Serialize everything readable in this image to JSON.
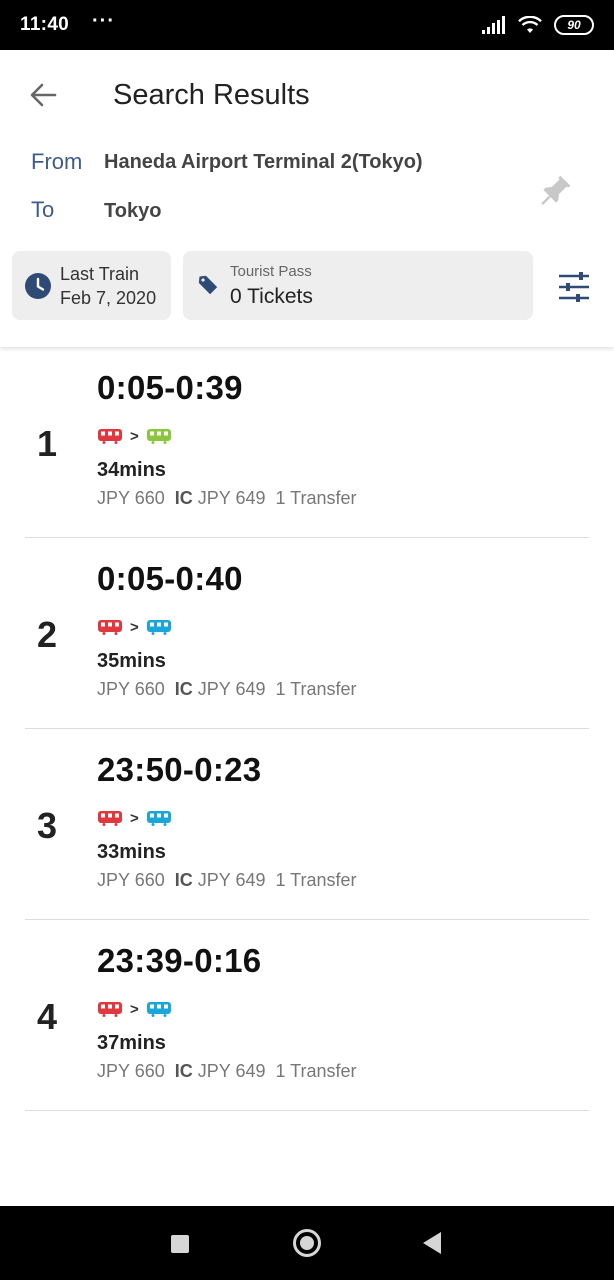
{
  "status_bar": {
    "time": "11:40",
    "dots": "···",
    "battery": "90"
  },
  "header": {
    "title": "Search Results",
    "from_label": "From",
    "from_value": "Haneda Airport Terminal 2(Tokyo)",
    "to_label": "To",
    "to_value": "Tokyo",
    "time_chip": {
      "line1": "Last Train",
      "line2": "Feb 7, 2020"
    },
    "pass_chip": {
      "label": "Tourist Pass",
      "count": "0 Tickets"
    }
  },
  "colors": {
    "accent": "#3e5c8a",
    "train_red": "#e0383e",
    "train_green": "#8cc63f",
    "train_blue": "#1aa6d8"
  },
  "results": [
    {
      "index": "1",
      "time": "0:05-0:39",
      "duration": "34mins",
      "fare": "JPY 660",
      "ic_label": "IC",
      "ic_fare": "JPY 649",
      "transfer": "1 Transfer",
      "lines": [
        "red-train-icon",
        "green-train-icon"
      ]
    },
    {
      "index": "2",
      "time": "0:05-0:40",
      "duration": "35mins",
      "fare": "JPY 660",
      "ic_label": "IC",
      "ic_fare": "JPY 649",
      "transfer": "1 Transfer",
      "lines": [
        "red-train-icon",
        "blue-train-icon"
      ]
    },
    {
      "index": "3",
      "time": "23:50-0:23",
      "duration": "33mins",
      "fare": "JPY 660",
      "ic_label": "IC",
      "ic_fare": "JPY 649",
      "transfer": "1 Transfer",
      "lines": [
        "red-train-icon",
        "blue-train-icon"
      ]
    },
    {
      "index": "4",
      "time": "23:39-0:16",
      "duration": "37mins",
      "fare": "JPY 660",
      "ic_label": "IC",
      "ic_fare": "JPY 649",
      "transfer": "1 Transfer",
      "lines": [
        "red-train-icon",
        "blue-train-icon"
      ]
    }
  ]
}
